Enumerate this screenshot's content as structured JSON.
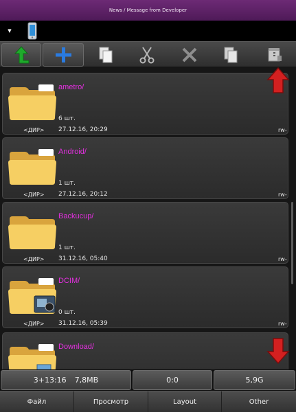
{
  "titlebar": {
    "title": "News / Message from Developer"
  },
  "drivebar": {
    "dropdown_glyph": "▼",
    "device_icon": "phone-icon"
  },
  "toolbar": {
    "buttons": [
      {
        "name": "go-up-button",
        "icon": "arrow-up-green-icon"
      },
      {
        "name": "new-button",
        "icon": "plus-blue-icon"
      },
      {
        "name": "copy-button",
        "icon": "copy-pages-icon"
      },
      {
        "name": "cut-button",
        "icon": "scissors-icon"
      },
      {
        "name": "delete-button",
        "icon": "cross-icon"
      },
      {
        "name": "paste-button",
        "icon": "paste-pages-icon"
      },
      {
        "name": "archive-button",
        "icon": "zip-archive-icon"
      }
    ]
  },
  "files": [
    {
      "name": "ametro/",
      "count": "6 шт.",
      "type": "<ДИР>",
      "date": "27.12.16, 20:29",
      "perm": "rw-"
    },
    {
      "name": "Android/",
      "count": "1 шт.",
      "type": "<ДИР>",
      "date": "27.12.16, 20:12",
      "perm": "rw-"
    },
    {
      "name": "Backucup/",
      "count": "1 шт.",
      "type": "<ДИР>",
      "date": "31.12.16, 05:40",
      "perm": "rw-"
    },
    {
      "name": "DCIM/",
      "count": "0 шт.",
      "type": "<ДИР>",
      "date": "31.12.16, 05:39",
      "perm": "rw-"
    },
    {
      "name": "Download/",
      "count": "",
      "type": "",
      "date": "",
      "perm": ""
    }
  ],
  "status": {
    "selection": "3+13:16",
    "size": "7,8MB",
    "selected": "0:0",
    "free": "5,9G"
  },
  "bottom_tabs": [
    "Файл",
    "Просмотр",
    "Layout",
    "Other"
  ],
  "colors": {
    "accent": "#6d2a75",
    "filename": "#e52fe1",
    "scroll_arrow": "#d32020"
  }
}
